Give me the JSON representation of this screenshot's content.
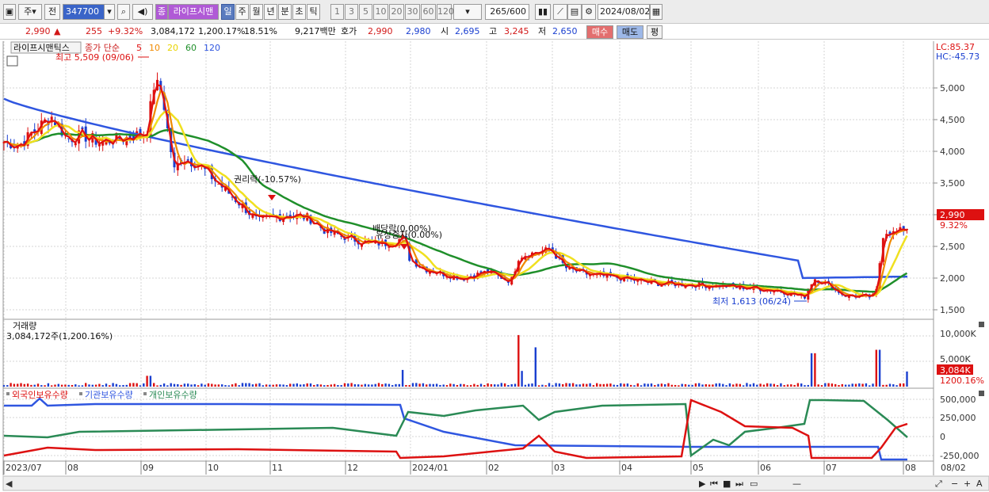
{
  "toolbar": {
    "period_mode": "주",
    "prev_label": "전",
    "stock_code": "347700",
    "stock_badge": "종",
    "stock_name": "라이프시맨",
    "periods": [
      "일",
      "주",
      "월",
      "년",
      "분",
      "초",
      "틱"
    ],
    "selected_period": "일",
    "intervals": [
      "1",
      "3",
      "5",
      "10",
      "20",
      "30",
      "60",
      "120"
    ],
    "count": "265",
    "count_max": "/600",
    "date": "2024/08/02"
  },
  "quote": {
    "price": "2,990",
    "change_arrow": "▲",
    "change": "255",
    "change_pct": "+9.32%",
    "volume": "3,084,172",
    "volume_pct": "1,200.17%",
    "turnover_pct": "18.51%",
    "amount": "9,217백만",
    "hoga_label": "호가",
    "ask": "2,990",
    "bid": "2,980",
    "open_label": "시",
    "open": "2,695",
    "high_label": "고",
    "high": "3,245",
    "low_label": "저",
    "low": "2,650",
    "buy_label": "매수",
    "sell_label": "매도",
    "eval_label": "평"
  },
  "price_panel": {
    "stock_label": "라이프시맨틱스",
    "ma_label": "종가 단순",
    "ma_periods": [
      {
        "p": "5",
        "color": "#e01010"
      },
      {
        "p": "10",
        "color": "#f08a00"
      },
      {
        "p": "20",
        "color": "#e8d400"
      },
      {
        "p": "60",
        "color": "#1f8f2a"
      },
      {
        "p": "120",
        "color": "#2f56e0"
      }
    ],
    "high_note": "최고 5,509 (09/06)",
    "low_note": "최저 1,613 (06/24)",
    "rights_note": "권리락(-10.57%)",
    "div_note": "배당락(0.00%)",
    "bonus_note": "유상증자(0.00%)",
    "lc": "LC:85.37",
    "hc": "HC:-45.73",
    "current_price": "2,990",
    "current_pct": "9.32%",
    "y_ticks": [
      "5,000",
      "4,500",
      "4,000",
      "3,500",
      "3,000",
      "2,500",
      "2,000",
      "1,500"
    ]
  },
  "volume_panel": {
    "title": "거래량",
    "value": "3,084,172주(1,200.16%)",
    "y_ticks": [
      "10,000K",
      "5,000K"
    ],
    "current": "3,084K",
    "current_pct": "1200.16%"
  },
  "holder_panel": {
    "legend": [
      {
        "label": "외국인보유수량",
        "color": "#d11"
      },
      {
        "label": "기관보유수량",
        "color": "#2f56e0"
      },
      {
        "label": "개인보유수량",
        "color": "#2a8a55"
      }
    ],
    "y_ticks": [
      "500,000",
      "250,000",
      "0",
      "-250,000"
    ]
  },
  "x_axis": [
    "2023/07",
    "08",
    "09",
    "10",
    "11",
    "12",
    "2024/01",
    "02",
    "03",
    "04",
    "05",
    "06",
    "07",
    "08"
  ],
  "x_axis_right": "08/02",
  "chart_data": {
    "type": "candlestick",
    "date_range": [
      "2023/07",
      "2024/08/02"
    ],
    "y_range": [
      1500,
      5000
    ],
    "high": {
      "value": 5509,
      "date": "09/06"
    },
    "low": {
      "value": 1613,
      "date": "06/24"
    },
    "last": {
      "price": 2990,
      "open": 2695,
      "high": 3245,
      "low": 2650
    }
  }
}
